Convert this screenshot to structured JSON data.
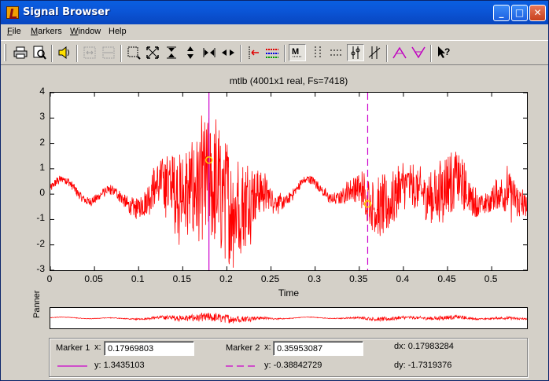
{
  "window": {
    "title": "Signal Browser"
  },
  "menu": [
    {
      "label": "File",
      "u": "F",
      "rest": "ile"
    },
    {
      "label": "Markers",
      "u": "M",
      "rest": "arkers"
    },
    {
      "label": "Window",
      "u": "W",
      "rest": "indow"
    },
    {
      "label": "Help",
      "u": "",
      "rest": "Help"
    }
  ],
  "toolbar_icons": [
    "printer-icon",
    "print-preview-icon",
    "speaker-icon",
    "zoom-in-x-icon",
    "zoom-out-x-icon",
    "zoom-box-icon",
    "full-view-icon",
    "vertical-zoom-in-icon",
    "vertical-zoom-out-icon",
    "horizontal-zoom-in-icon",
    "horizontal-zoom-out-icon",
    "select-signal-icon",
    "array-signals-icon",
    "marker-toggle-icon",
    "vertical-markers-icon",
    "horizontal-markers-icon",
    "track-markers-icon",
    "slope-markers-icon",
    "peaks-icon",
    "valleys-icon",
    "whats-this-icon"
  ],
  "plot": {
    "title": "mtlb (4001x1 real, Fs=7418)",
    "xlabel": "Time",
    "panner_label": "Panner"
  },
  "chart_data": {
    "type": "line",
    "title": "mtlb (4001x1 real, Fs=7418)",
    "xlabel": "Time",
    "ylabel": "",
    "xlim": [
      0,
      0.54
    ],
    "ylim": [
      -3,
      4
    ],
    "xticks": [
      "0",
      "0.05",
      "0.1",
      "0.15",
      "0.2",
      "0.25",
      "0.3",
      "0.35",
      "0.4",
      "0.45",
      "0.5"
    ],
    "yticks": [
      "4",
      "3",
      "2",
      "1",
      "0",
      "-1",
      "-2",
      "-3"
    ],
    "series": [
      {
        "color": "#ff0000",
        "samples": 4001,
        "fs": 7418
      }
    ],
    "markers": [
      {
        "x": 0.17969803,
        "y": 1.3435103,
        "color": "#cc00cc",
        "style": "solid"
      },
      {
        "x": 0.35953087,
        "y": -0.38842729,
        "color": "#cc00cc",
        "style": "dashed"
      }
    ]
  },
  "readout": {
    "marker1_label": "Marker 1",
    "marker2_label": "Marker 2",
    "x_label": "x:",
    "marker1_x": "0.17969803",
    "marker2_x": "0.35953087",
    "marker1_y": "y: 1.3435103",
    "marker2_y": "y: -0.38842729",
    "dx": "dx: 0.17983284",
    "dy": "dy: -1.7319376"
  }
}
